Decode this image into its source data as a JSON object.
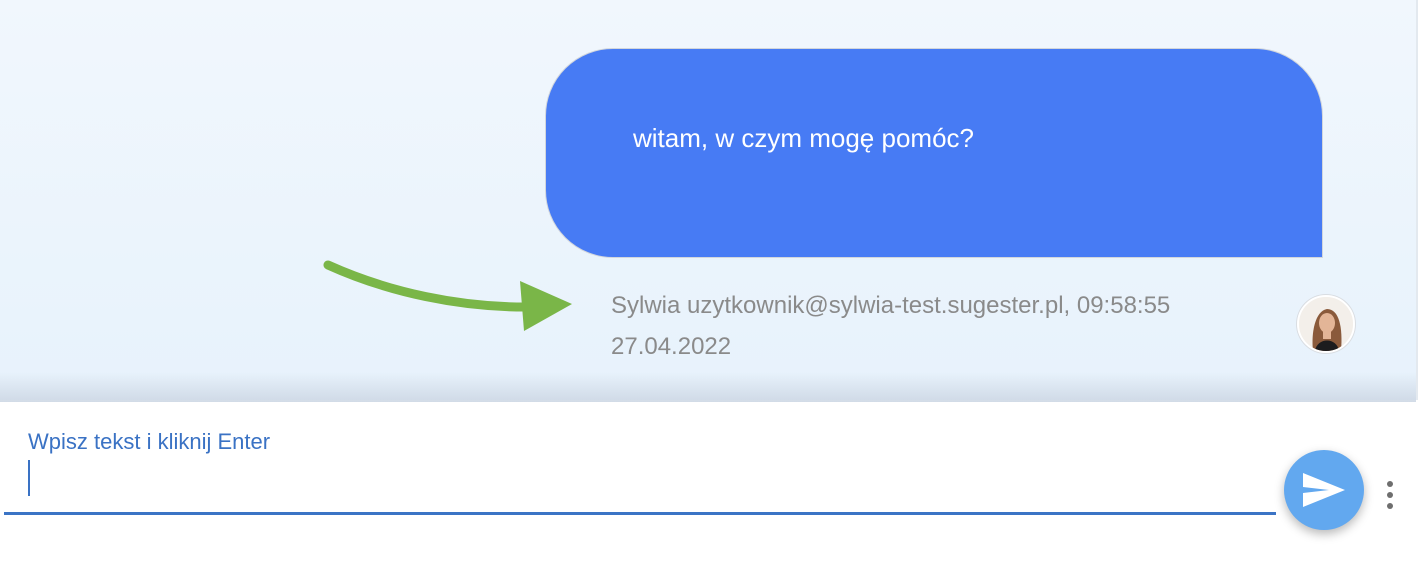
{
  "message": {
    "text": "witam, w czym mogę pomóc?",
    "meta_line1": "Sylwia uzytkownik@sylwia-test.sugester.pl, 09:58:55",
    "meta_line2": "27.04.2022"
  },
  "composer": {
    "label": "Wpisz tekst i kliknij Enter",
    "value": ""
  },
  "icons": {
    "send": "send-icon",
    "more": "more-vertical-icon",
    "annotation": "arrow-annotation-icon"
  },
  "colors": {
    "bubble": "#477bf4",
    "send_button": "#62a8ef",
    "annotation_arrow": "#7ab648",
    "input_accent": "#3b74c5"
  }
}
